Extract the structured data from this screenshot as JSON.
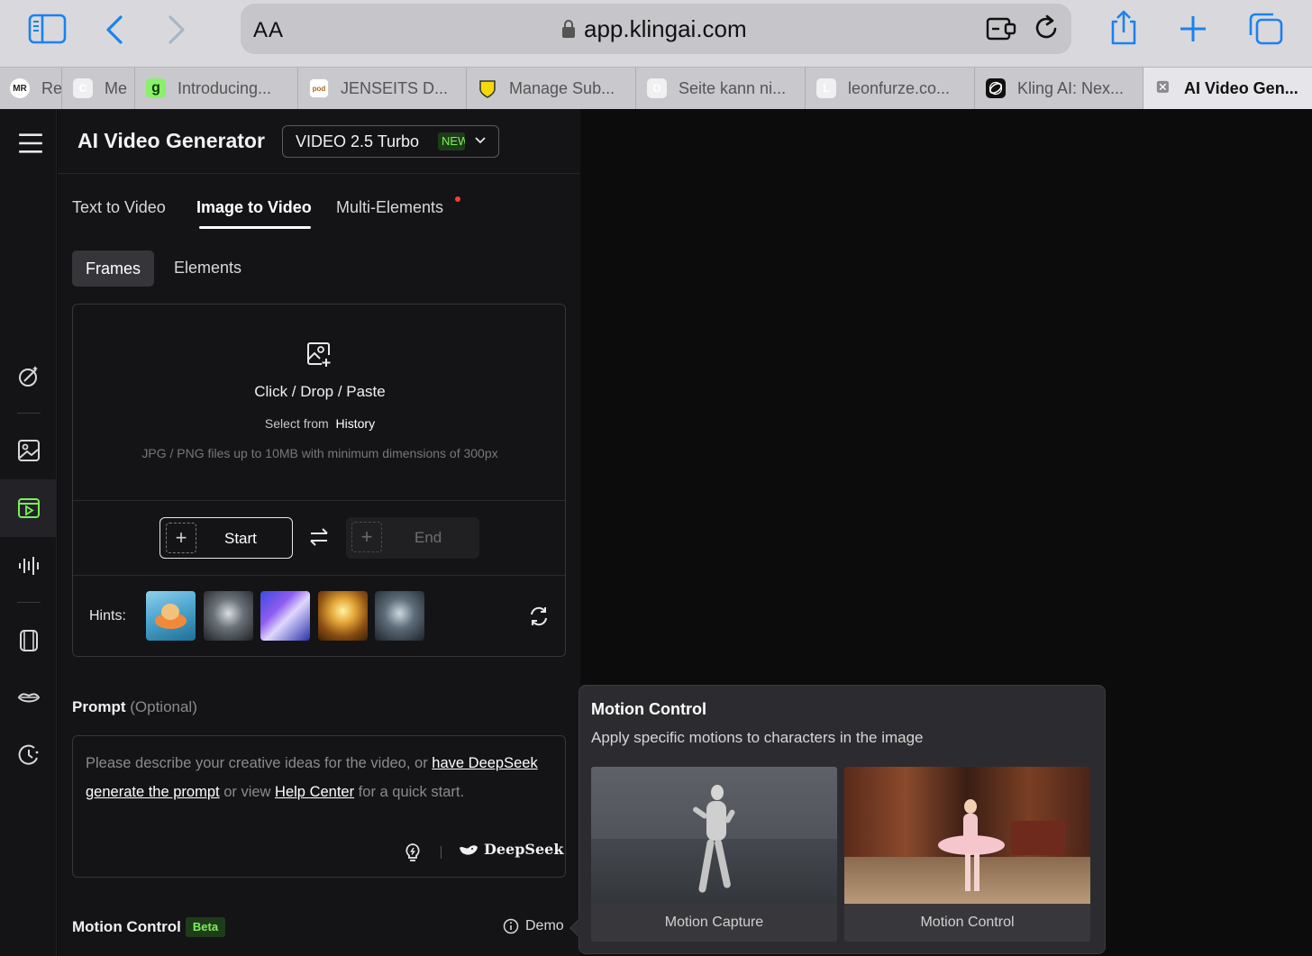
{
  "browser": {
    "font_size_label": "AA",
    "url": "app.klingai.com",
    "tabs": [
      {
        "label": "Re",
        "favicon": "MR"
      },
      {
        "label": "Me",
        "favicon": "C"
      },
      {
        "label": "Introducing...",
        "favicon": "g"
      },
      {
        "label": "JENSEITS D...",
        "favicon": "pod"
      },
      {
        "label": "Manage Sub...",
        "favicon": "shield"
      },
      {
        "label": "Seite kann ni...",
        "favicon": "O"
      },
      {
        "label": "leonfurze.co...",
        "favicon": "L"
      },
      {
        "label": "Kling AI: Nex...",
        "favicon": "kling"
      },
      {
        "label": "AI Video Gen...",
        "favicon": "close"
      }
    ]
  },
  "header": {
    "title": "AI Video Generator",
    "model": "VIDEO 2.5 Turbo",
    "model_badge": "NEW"
  },
  "mode_tabs": [
    "Text to Video",
    "Image to Video",
    "Multi-Elements"
  ],
  "segments": [
    "Frames",
    "Elements"
  ],
  "upload": {
    "main": "Click / Drop / Paste",
    "history_prefix": "Select from",
    "history_link": "History",
    "note": "JPG / PNG files up to 10MB with minimum dimensions of 300px"
  },
  "frames": {
    "start": "Start",
    "end": "End"
  },
  "hints_label": "Hints:",
  "prompt": {
    "label": "Prompt",
    "optional": "(Optional)",
    "text_1": "Please describe your creative ideas for the video, or ",
    "link_1": "have DeepSeek generate the prompt",
    "text_2": " or view ",
    "link_2": "Help Center",
    "text_3": " for a quick start.",
    "deepseek": "DeepSeek"
  },
  "motion_control": {
    "label": "Motion Control",
    "badge": "Beta",
    "demo": "Demo"
  },
  "tooltip": {
    "title": "Motion Control",
    "description": "Apply specific motions to characters in the image",
    "cards": [
      "Motion Capture",
      "Motion Control"
    ]
  },
  "colors": {
    "accent_green": "#7cf05a",
    "safari_blue": "#1a82f0",
    "background": "#0c0c0d"
  }
}
